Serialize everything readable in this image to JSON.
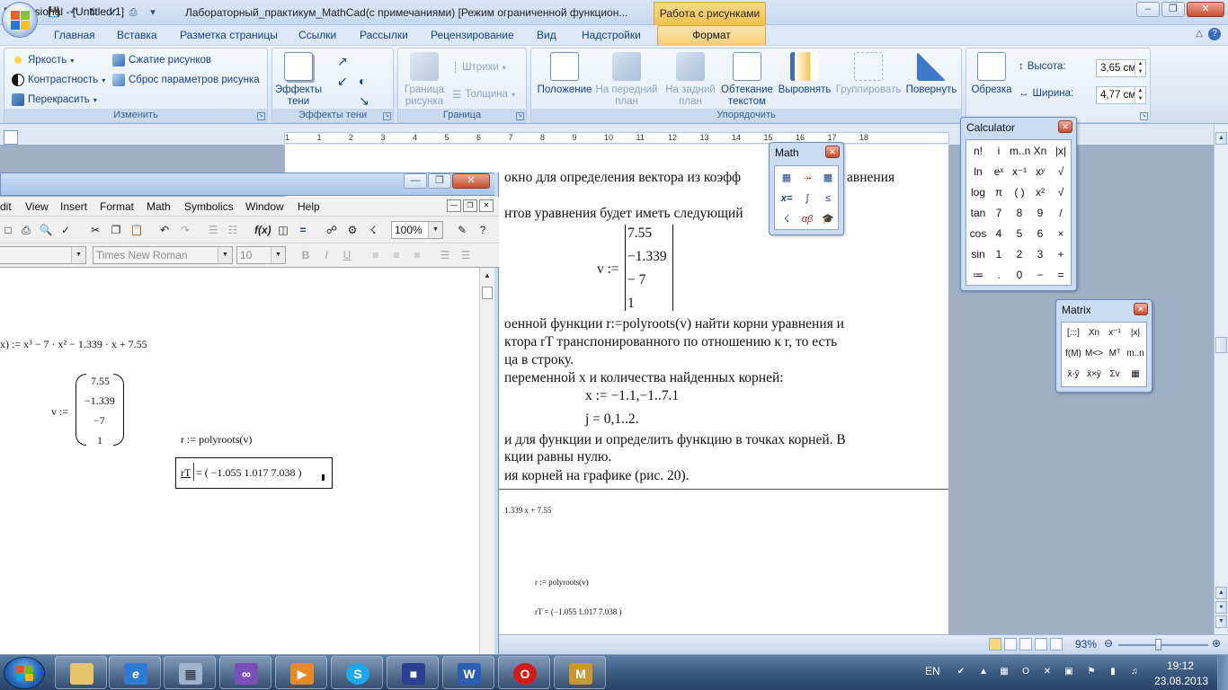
{
  "word": {
    "title": "Лабораторный_практикум_MathCad(с примечаниями) [Режим ограниченной функцион...",
    "context_tab_title": "Работа с рисунками",
    "window_controls": {
      "minimize": "–",
      "restore": "❐",
      "close": "✕"
    },
    "ribbon_tabs": [
      "Главная",
      "Вставка",
      "Разметка страницы",
      "Ссылки",
      "Рассылки",
      "Рецензирование",
      "Вид",
      "Надстройки",
      "Формат"
    ],
    "active_tab": "Формат",
    "groups": {
      "izmenit": {
        "label": "Изменить",
        "items": [
          "Яркость",
          "Контрастность",
          "Перекрасить",
          "Сжатие рисунков",
          "Сброс параметров рисунка"
        ]
      },
      "effekty_teni": {
        "label": "Эффекты тени",
        "button": "Эффекты тени"
      },
      "granica": {
        "label": "Граница",
        "items": [
          "Граница рисунка",
          "Штрихи",
          "Толщина"
        ]
      },
      "uporyadochit": {
        "label": "Упорядочить",
        "buttons": [
          "Положение",
          "На передний план",
          "На задний план",
          "Обтекание текстом",
          "Выровнять",
          "Группировать",
          "Повернуть"
        ]
      },
      "razmer": {
        "crop": "Обрезка",
        "height_label": "Высота:",
        "height_value": "3,65 см",
        "width_label": "Ширина:",
        "width_value": "4,77 см"
      }
    },
    "ruler_marks": [
      "1",
      "1",
      "2",
      "3",
      "4",
      "5",
      "6",
      "7",
      "8",
      "9",
      "10",
      "11",
      "12",
      "13",
      "14",
      "15",
      "16",
      "17",
      "18"
    ],
    "document_lines": {
      "l1": "окно для определения вектора из коэфф",
      "l1b": "авнения",
      "l2": "нтов  уравнения будет иметь следующий",
      "vec_label": "v :=",
      "vec_values": [
        "7.55",
        "−1.339",
        "− 7",
        "1"
      ],
      "l3": "оенной  функции  r:=polyroots(v)  найти  корни  уравнения  и",
      "l4": "ктора  rT  транспонированного  по  отношению  к  r,  то  есть",
      "l5": "ца в строку.",
      "l6": "переменной x и количества найденных корней:",
      "l7": "x := −1.1,−1..7.1",
      "l8": "j = 0,1..2.",
      "l9": "и  для  функции  и  определить  функцию  в  точках  корней.  В",
      "l10": "кции равны нулю.",
      "l11": "ия корней на графике (рис. 20).",
      "p2_a": "1.339 x + 7.55",
      "p2_b": "r := polyroots(v)",
      "p2_c": "rT = (−1.055   1.017   7.038 )"
    },
    "zoom": "93%"
  },
  "mathcad": {
    "title": "Professional - [Untitled:1]",
    "menus": [
      "dit",
      "View",
      "Insert",
      "Format",
      "Math",
      "Symbolics",
      "Window",
      "Help"
    ],
    "zoom_combo": "100%",
    "font_combo": "Times New Roman",
    "size_combo": "10",
    "worksheet": {
      "func": "x) := x³ − 7 · x² − 1.339 · x + 7.55",
      "v_label": "v :=",
      "v_values": [
        "7.55",
        "−1.339",
        "−7",
        "1"
      ],
      "polyroots": "r := polyroots(v)",
      "result_lhs": "rT",
      "result_eq": "= ( −1.055   1.017   7.038 )"
    }
  },
  "palettes": {
    "math": {
      "title": "Math",
      "icons": [
        "calculator",
        "graph",
        "matrix",
        "evaluation",
        "calculus",
        "boolean",
        "programming",
        "greek",
        "symbolic"
      ]
    },
    "calculator": {
      "title": "Calculator",
      "buttons": [
        [
          "n!",
          "i",
          "m..n",
          "Xn",
          "|x|"
        ],
        [
          "ln",
          "eˣ",
          "x⁻¹",
          "xʸ",
          "√"
        ],
        [
          "log",
          "π",
          "( )",
          "x²",
          "√"
        ],
        [
          "tan",
          "7",
          "8",
          "9",
          "/"
        ],
        [
          "cos",
          "4",
          "5",
          "6",
          "×"
        ],
        [
          "sin",
          "1",
          "2",
          "3",
          "+"
        ],
        [
          "≔",
          ".",
          "0",
          "−",
          "="
        ]
      ]
    },
    "matrix": {
      "title": "Matrix",
      "buttons": [
        [
          "[:::]",
          "Xn",
          "x⁻¹",
          "|x|"
        ],
        [
          "f(M)",
          "M<>",
          "Mᵀ",
          "m..n"
        ],
        [
          "x̄·ȳ",
          "x̄×ȳ",
          "Σv",
          "▦"
        ]
      ]
    }
  },
  "taskbar": {
    "apps": [
      "explorer",
      "ie",
      "calculator",
      "vs",
      "media",
      "skype",
      "save",
      "word",
      "opera",
      "mathcad"
    ],
    "lang": "EN",
    "time": "19:12",
    "date": "23.08.2013"
  },
  "colors": {
    "accent": "#15428b",
    "context_tab": "#f0c14b",
    "taskbar": "#3b5a80"
  }
}
